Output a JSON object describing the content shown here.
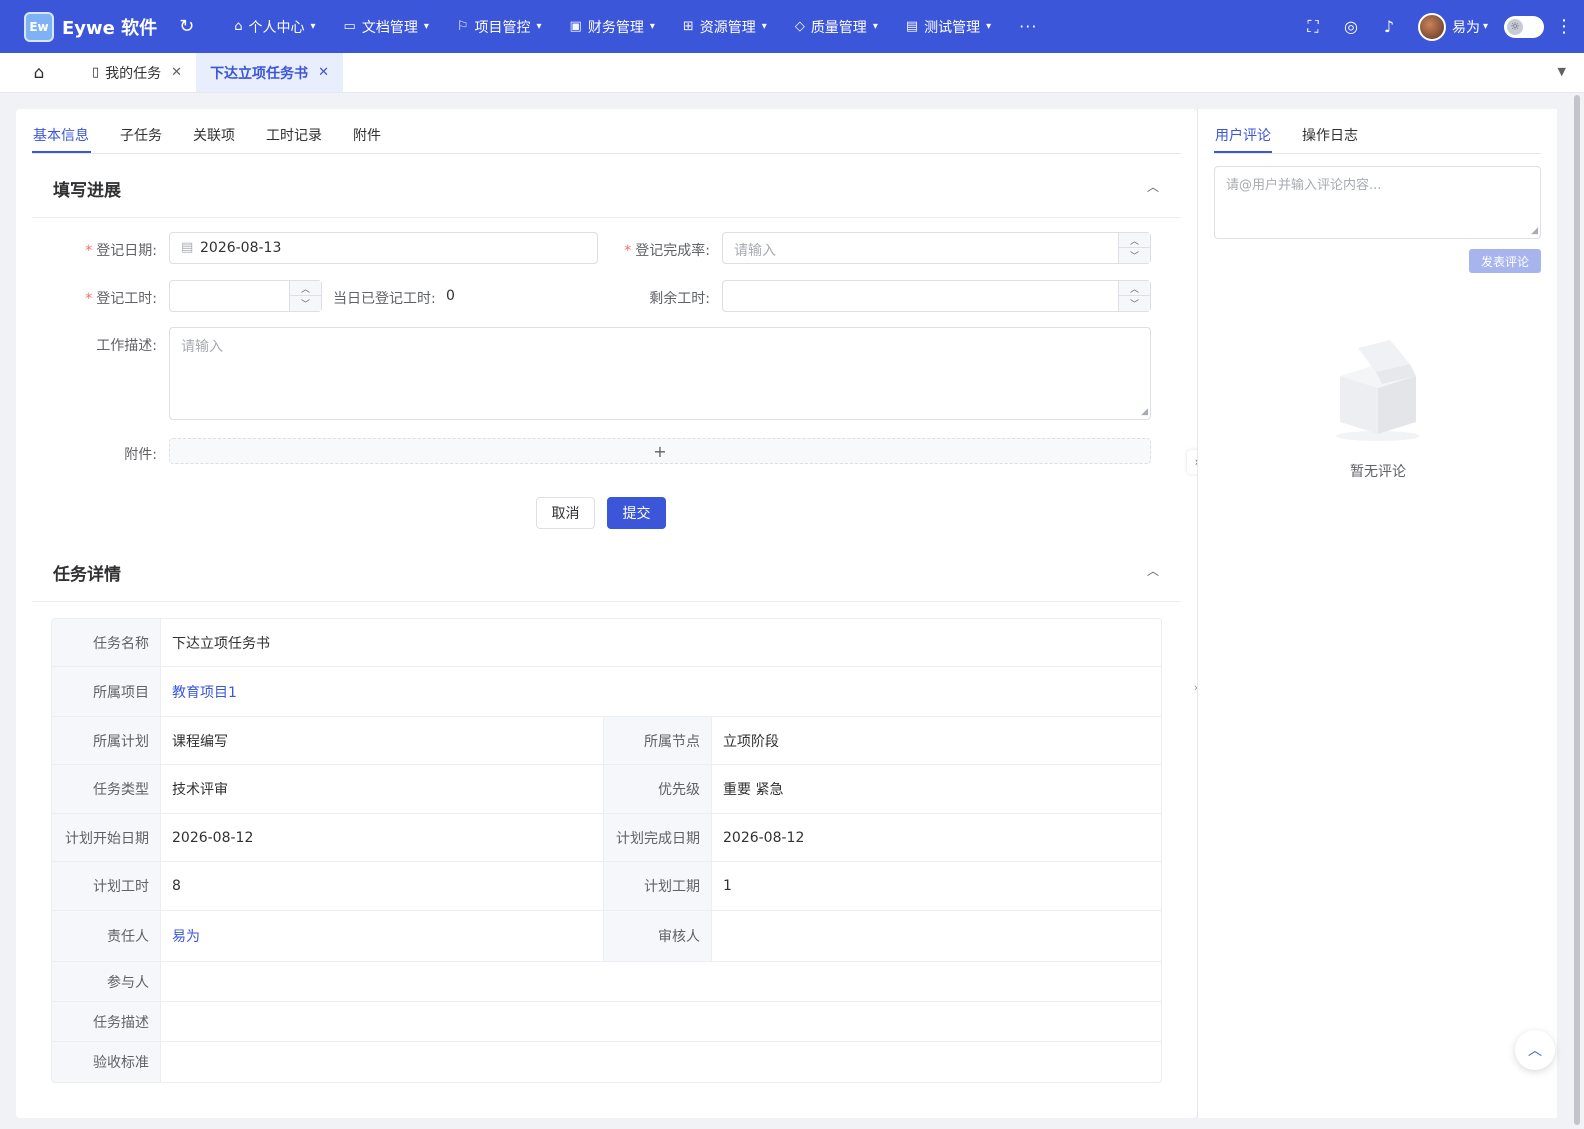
{
  "app": {
    "logo_mark": "Ew",
    "name": "Eywe 软件"
  },
  "nav": [
    {
      "label": "个人中心",
      "icon": "home-icon"
    },
    {
      "label": "文档管理",
      "icon": "folder-icon"
    },
    {
      "label": "项目管控",
      "icon": "flag-icon"
    },
    {
      "label": "财务管理",
      "icon": "finance-icon"
    },
    {
      "label": "资源管理",
      "icon": "org-icon"
    },
    {
      "label": "质量管理",
      "icon": "shield-icon"
    },
    {
      "label": "测试管理",
      "icon": "calendar-icon"
    }
  ],
  "nav_more": "···",
  "user": {
    "name": "易为"
  },
  "page_tabs": [
    {
      "label": "我的任务",
      "active": false
    },
    {
      "label": "下达立项任务书",
      "active": true
    }
  ],
  "inner_tabs": [
    "基本信息",
    "子任务",
    "关联项",
    "工时记录",
    "附件"
  ],
  "progress": {
    "title": "填写进展",
    "date_label": "登记日期:",
    "date_value": "2026-08-13",
    "rate_label": "登记完成率:",
    "rate_placeholder": "请输入",
    "hours_label": "登记工时:",
    "today_hours_label": "当日已登记工时:",
    "today_hours_value": "0",
    "remaining_label": "剩余工时:",
    "desc_label": "工作描述:",
    "desc_placeholder": "请输入",
    "attach_label": "附件:",
    "cancel": "取消",
    "submit": "提交"
  },
  "details": {
    "title": "任务详情",
    "task_name_label": "任务名称",
    "task_name": "下达立项任务书",
    "project_label": "所属项目",
    "project": "教育项目1",
    "plan_label": "所属计划",
    "plan": "课程编写",
    "node_label": "所属节点",
    "node": "立项阶段",
    "type_label": "任务类型",
    "type": "技术评审",
    "priority_label": "优先级",
    "priority": "重要 紧急",
    "start_label": "计划开始日期",
    "start": "2026-08-12",
    "end_label": "计划完成日期",
    "end": "2026-08-12",
    "plan_hours_label": "计划工时",
    "plan_hours": "8",
    "plan_period_label": "计划工期",
    "plan_period": "1",
    "owner_label": "责任人",
    "owner": "易为",
    "reviewer_label": "审核人",
    "reviewer": "",
    "participants_label": "参与人",
    "participants": "",
    "desc_label": "任务描述",
    "desc": "",
    "acceptance_label": "验收标准",
    "acceptance": ""
  },
  "side": {
    "tabs": [
      "用户评论",
      "操作日志"
    ],
    "comment_placeholder": "请@用户并输入评论内容...",
    "post": "发表评论",
    "empty": "暂无评论"
  },
  "colors": {
    "primary": "#3b56d8",
    "required": "#f56c6c"
  }
}
